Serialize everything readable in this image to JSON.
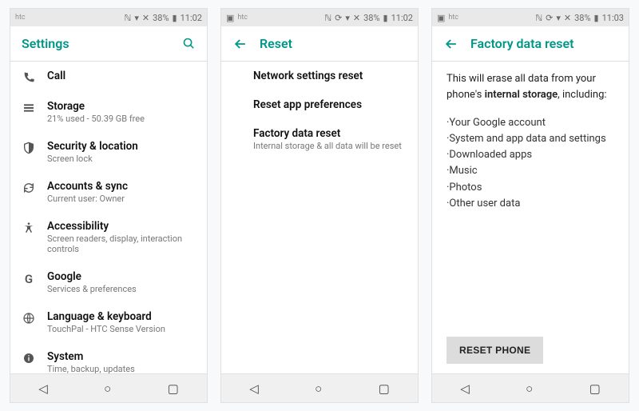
{
  "accent": "#009688",
  "screens": [
    {
      "status": {
        "carrier": "htc",
        "icons": "ℕ  ▾ ✕",
        "battery_pct": "38%",
        "time": "11:02",
        "app_badge": ""
      },
      "header": {
        "title": "Settings",
        "has_back": false,
        "has_search": true
      },
      "rows": [
        {
          "icon": "phone",
          "title": "Call",
          "sub": ""
        },
        {
          "icon": "storage",
          "title": "Storage",
          "sub": "21% used - 50.39 GB free"
        },
        {
          "icon": "security",
          "title": "Security & location",
          "sub": "Screen lock"
        },
        {
          "icon": "sync",
          "title": "Accounts & sync",
          "sub": "Current user: Owner"
        },
        {
          "icon": "accessibility",
          "title": "Accessibility",
          "sub": "Screen readers, display, interaction controls"
        },
        {
          "icon": "google",
          "title": "Google",
          "sub": "Services & preferences"
        },
        {
          "icon": "language",
          "title": "Language & keyboard",
          "sub": "TouchPal - HTC Sense Version"
        },
        {
          "icon": "info",
          "title": "System",
          "sub": "Time, backup, updates"
        }
      ]
    },
    {
      "status": {
        "carrier": "htc",
        "icons": "ℕ ⟳ ▾ ✕",
        "battery_pct": "38%",
        "time": "11:02",
        "app_badge": ""
      },
      "header": {
        "title": "Reset",
        "has_back": true,
        "has_search": false
      },
      "rows": [
        {
          "icon": "",
          "title": "Network settings reset",
          "sub": ""
        },
        {
          "icon": "",
          "title": "Reset app preferences",
          "sub": ""
        },
        {
          "icon": "",
          "title": "Factory data reset",
          "sub": "Internal storage & all data will be reset"
        }
      ]
    },
    {
      "status": {
        "carrier": "htc",
        "icons": "ℕ ⟳ ▾ ✕",
        "battery_pct": "38%",
        "time": "11:03",
        "app_badge": "▣"
      },
      "header": {
        "title": "Factory data reset",
        "has_back": true,
        "has_search": false
      },
      "desc_pre": "This will erase all data from your phone's ",
      "desc_bold": "internal storage",
      "desc_post": ", including:",
      "bullets": [
        "·Your Google account",
        "·System and app data and settings",
        "·Downloaded apps",
        "·Music",
        "·Photos",
        "·Other user data"
      ],
      "button": "RESET PHONE"
    }
  ],
  "navlabels": {
    "back": "◁",
    "home": "○",
    "recents": "▢"
  }
}
